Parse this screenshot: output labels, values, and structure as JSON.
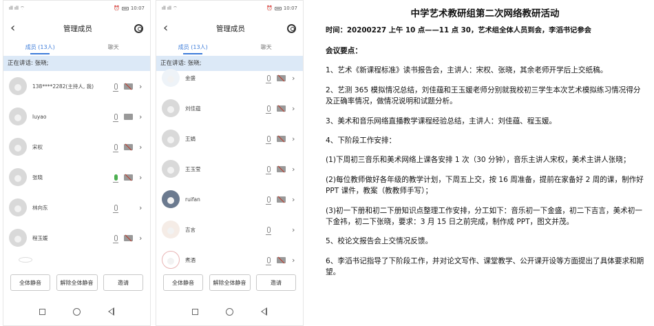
{
  "status_left": "ıll ıll ⌔",
  "status_time": "10:07",
  "phone": {
    "title": "管理成员",
    "tab_members": "成员 (13人)",
    "tab_chat": "聊天",
    "speaking": "正在讲话: 张晓;",
    "btn_mute_all": "全体静音",
    "btn_unmute_all": "解除全体静音",
    "btn_invite": "邀请"
  },
  "list1": [
    {
      "name": "138****2282(主持人, 我)",
      "mic": "gray",
      "cam": "off"
    },
    {
      "name": "luyao",
      "mic": "gray",
      "cam": "on"
    },
    {
      "name": "宋权",
      "mic": "gray",
      "cam": "off"
    },
    {
      "name": "张晓",
      "mic": "green",
      "cam": "off"
    },
    {
      "name": "林向东",
      "mic": "gray",
      "cam": "none"
    },
    {
      "name": "程玉媛",
      "mic": "gray",
      "cam": "off"
    }
  ],
  "list2": [
    {
      "name": "金盛",
      "mic": "gray",
      "cam": "off"
    },
    {
      "name": "刘佳蕴",
      "mic": "gray",
      "cam": "off"
    },
    {
      "name": "王娟",
      "mic": "gray",
      "cam": "off"
    },
    {
      "name": "王玉莹",
      "mic": "gray",
      "cam": "off"
    },
    {
      "name": "ruifan",
      "mic": "gray",
      "cam": "off"
    },
    {
      "name": "吉言",
      "mic": "gray",
      "cam": "none"
    },
    {
      "name": "煮酒",
      "mic": "gray",
      "cam": "off"
    }
  ],
  "doc": {
    "title": "中学艺术教研组第二次网络教研活动",
    "time": "时间：20200227 上午 10 点——11 点 30，艺术组全体人员到会，李滔书记参会",
    "points_head": "会议要点：",
    "items": [
      "1、艺术《新课程标准》读书报告会，主讲人：宋权、张晓，其余老师开学后上交纸稿。",
      "2、艺测 365 模拟情况总结，刘佳蕴和王玉媛老师分别就我校初三学生本次艺术模拟练习情况得分及正确率情况，做情况说明和试题分析。",
      "3、美术和音乐网络直播教学课程经验总结，主讲人：刘佳蕴、程玉媛。",
      "4、下阶段工作安排：",
      "(1)下周初三音乐和美术网络上课各安排 1 次（30 分钟），音乐主讲人宋权，美术主讲人张晓；",
      "(2)每位教师做好各年级的教学计划，下周五上交，按 16 周准备，提前在家备好 2 周的课，制作好 PPT 课件，教案（教教师手写）；",
      "(3)初一下册和初二下册知识点整理工作安排，分工如下：音乐初一下金盛，初二下吉言，美术初一下金祎，初二下张晓，要求：3 月 15 日之前完成，制作成 PPT，图文并茂。",
      "5、校论文报告会上交情况反馈。",
      "6、李滔书记指导了下阶段工作，并对论文写作、课堂教学、公开课开设等方面提出了具体要求和期望。"
    ]
  }
}
